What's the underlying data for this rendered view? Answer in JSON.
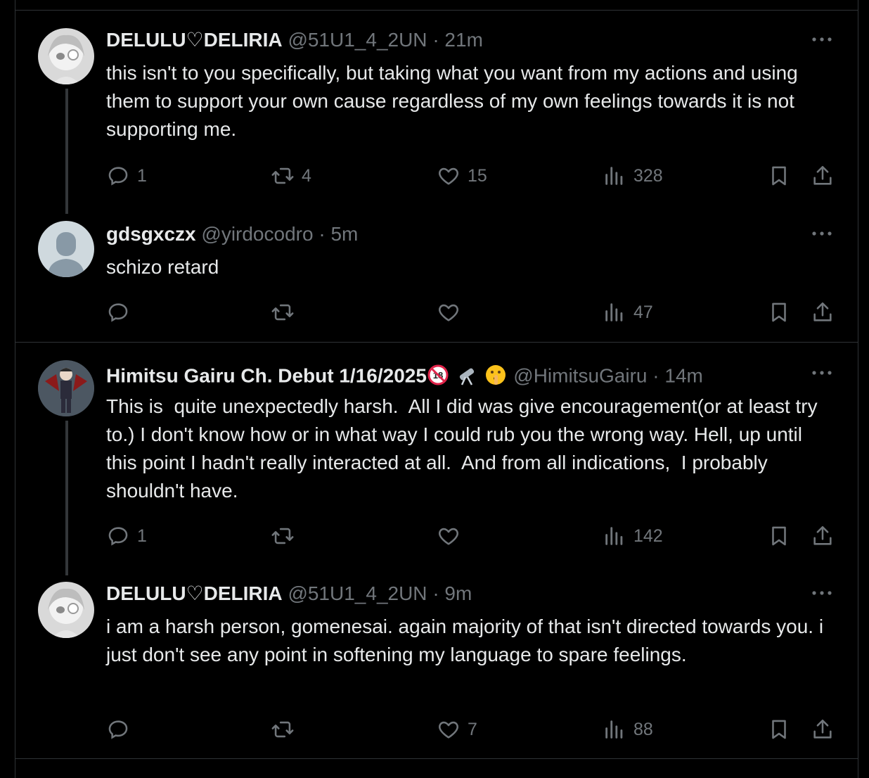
{
  "tweets": [
    {
      "name": "DELULU♡DELIRIA",
      "handle": "@51U1_4_2UN",
      "sep": "·",
      "time": "21m",
      "text": "this isn't to you specifically, but taking what you want from my actions and using them to support your own cause regardless of my own feelings towards it is not supporting me.",
      "replies": "1",
      "retweets": "4",
      "likes": "15",
      "views": "328",
      "avatar_icon": "anime-avatar-white-hair"
    },
    {
      "name": "gdsgxczx",
      "handle": "@yirdocodro",
      "sep": "·",
      "time": "5m",
      "text": "schizo retard",
      "replies": "",
      "retweets": "",
      "likes": "",
      "views": "47",
      "avatar_icon": "default-avatar"
    },
    {
      "name": "Himitsu Gairu Ch. Debut 1/16/2025",
      "handle": "@HimitsuGairu",
      "sep": "·",
      "time": "14m",
      "text": "This is  quite unexpectedly harsh.  All I did was give encouragement(or at least try to.) I don't know how or in what way I could rub you the wrong way. Hell, up until this point I hadn't really interacted at all.  And from all indications,  I probably shouldn't have.",
      "replies": "1",
      "retweets": "",
      "likes": "",
      "views": "142",
      "avatar_icon": "vampire-character-avatar",
      "name_emojis": [
        "no-under-18-icon",
        "telescope-icon",
        "shushing-face-icon"
      ]
    },
    {
      "name": "DELULU♡DELIRIA",
      "handle": "@51U1_4_2UN",
      "sep": "·",
      "time": "9m",
      "text": "i am a harsh person, gomenesai. again majority of that isn't directed towards you. i just don't see any point in softening my language to spare feelings.",
      "replies": "",
      "retweets": "",
      "likes": "7",
      "views": "88",
      "avatar_icon": "anime-avatar-white-hair"
    }
  ],
  "colors": {
    "background": "#000000",
    "text": "#e7e9ea",
    "muted": "#71767b",
    "border": "#2f3336"
  }
}
